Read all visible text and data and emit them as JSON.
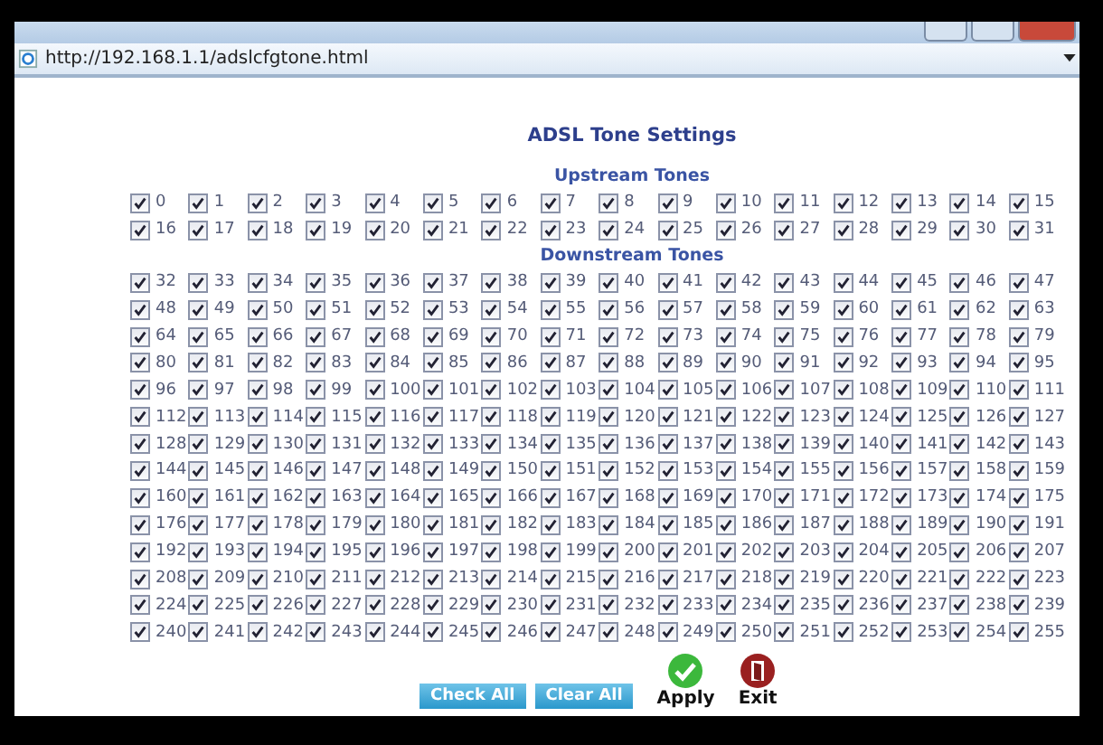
{
  "address_bar": {
    "url": "http://192.168.1.1/adslcfgtone.html"
  },
  "page": {
    "title": "ADSL Tone Settings",
    "upstream": {
      "heading": "Upstream Tones",
      "tones": [
        {
          "label": "0",
          "checked": true
        },
        {
          "label": "1",
          "checked": true
        },
        {
          "label": "2",
          "checked": true
        },
        {
          "label": "3",
          "checked": true
        },
        {
          "label": "4",
          "checked": true
        },
        {
          "label": "5",
          "checked": true
        },
        {
          "label": "6",
          "checked": true
        },
        {
          "label": "7",
          "checked": true
        },
        {
          "label": "8",
          "checked": true
        },
        {
          "label": "9",
          "checked": true
        },
        {
          "label": "10",
          "checked": true
        },
        {
          "label": "11",
          "checked": true
        },
        {
          "label": "12",
          "checked": true
        },
        {
          "label": "13",
          "checked": true
        },
        {
          "label": "14",
          "checked": true
        },
        {
          "label": "15",
          "checked": true
        },
        {
          "label": "16",
          "checked": true
        },
        {
          "label": "17",
          "checked": true
        },
        {
          "label": "18",
          "checked": true
        },
        {
          "label": "19",
          "checked": true
        },
        {
          "label": "20",
          "checked": true
        },
        {
          "label": "21",
          "checked": true
        },
        {
          "label": "22",
          "checked": true
        },
        {
          "label": "23",
          "checked": true
        },
        {
          "label": "24",
          "checked": true
        },
        {
          "label": "25",
          "checked": true
        },
        {
          "label": "26",
          "checked": true
        },
        {
          "label": "27",
          "checked": true
        },
        {
          "label": "28",
          "checked": true
        },
        {
          "label": "29",
          "checked": true
        },
        {
          "label": "30",
          "checked": true
        },
        {
          "label": "31",
          "checked": true
        }
      ]
    },
    "downstream": {
      "heading": "Downstream Tones",
      "tones": [
        {
          "label": "32",
          "checked": true
        },
        {
          "label": "33",
          "checked": true
        },
        {
          "label": "34",
          "checked": true
        },
        {
          "label": "35",
          "checked": true
        },
        {
          "label": "36",
          "checked": true
        },
        {
          "label": "37",
          "checked": true
        },
        {
          "label": "38",
          "checked": true
        },
        {
          "label": "39",
          "checked": true
        },
        {
          "label": "40",
          "checked": true
        },
        {
          "label": "41",
          "checked": true
        },
        {
          "label": "42",
          "checked": true
        },
        {
          "label": "43",
          "checked": true
        },
        {
          "label": "44",
          "checked": true
        },
        {
          "label": "45",
          "checked": true
        },
        {
          "label": "46",
          "checked": true
        },
        {
          "label": "47",
          "checked": true
        },
        {
          "label": "48",
          "checked": true
        },
        {
          "label": "49",
          "checked": true
        },
        {
          "label": "50",
          "checked": true
        },
        {
          "label": "51",
          "checked": true
        },
        {
          "label": "52",
          "checked": true
        },
        {
          "label": "53",
          "checked": true
        },
        {
          "label": "54",
          "checked": true
        },
        {
          "label": "55",
          "checked": true
        },
        {
          "label": "56",
          "checked": true
        },
        {
          "label": "57",
          "checked": true
        },
        {
          "label": "58",
          "checked": true
        },
        {
          "label": "59",
          "checked": true
        },
        {
          "label": "60",
          "checked": true
        },
        {
          "label": "61",
          "checked": true
        },
        {
          "label": "62",
          "checked": true
        },
        {
          "label": "63",
          "checked": true
        },
        {
          "label": "64",
          "checked": true
        },
        {
          "label": "65",
          "checked": true
        },
        {
          "label": "66",
          "checked": true
        },
        {
          "label": "67",
          "checked": true
        },
        {
          "label": "68",
          "checked": true
        },
        {
          "label": "69",
          "checked": true
        },
        {
          "label": "70",
          "checked": true
        },
        {
          "label": "71",
          "checked": true
        },
        {
          "label": "72",
          "checked": true
        },
        {
          "label": "73",
          "checked": true
        },
        {
          "label": "74",
          "checked": true
        },
        {
          "label": "75",
          "checked": true
        },
        {
          "label": "76",
          "checked": true
        },
        {
          "label": "77",
          "checked": true
        },
        {
          "label": "78",
          "checked": true
        },
        {
          "label": "79",
          "checked": true
        },
        {
          "label": "80",
          "checked": true
        },
        {
          "label": "81",
          "checked": true
        },
        {
          "label": "82",
          "checked": true
        },
        {
          "label": "83",
          "checked": true
        },
        {
          "label": "84",
          "checked": true
        },
        {
          "label": "85",
          "checked": true
        },
        {
          "label": "86",
          "checked": true
        },
        {
          "label": "87",
          "checked": true
        },
        {
          "label": "88",
          "checked": true
        },
        {
          "label": "89",
          "checked": true
        },
        {
          "label": "90",
          "checked": true
        },
        {
          "label": "91",
          "checked": true
        },
        {
          "label": "92",
          "checked": true
        },
        {
          "label": "93",
          "checked": true
        },
        {
          "label": "94",
          "checked": true
        },
        {
          "label": "95",
          "checked": true
        },
        {
          "label": "96",
          "checked": true
        },
        {
          "label": "97",
          "checked": true
        },
        {
          "label": "98",
          "checked": true
        },
        {
          "label": "99",
          "checked": true
        },
        {
          "label": "100",
          "checked": true
        },
        {
          "label": "101",
          "checked": true
        },
        {
          "label": "102",
          "checked": true
        },
        {
          "label": "103",
          "checked": true
        },
        {
          "label": "104",
          "checked": true
        },
        {
          "label": "105",
          "checked": true
        },
        {
          "label": "106",
          "checked": true
        },
        {
          "label": "107",
          "checked": true
        },
        {
          "label": "108",
          "checked": true
        },
        {
          "label": "109",
          "checked": true
        },
        {
          "label": "110",
          "checked": true
        },
        {
          "label": "111",
          "checked": true
        },
        {
          "label": "112",
          "checked": true
        },
        {
          "label": "113",
          "checked": true
        },
        {
          "label": "114",
          "checked": true
        },
        {
          "label": "115",
          "checked": true
        },
        {
          "label": "116",
          "checked": true
        },
        {
          "label": "117",
          "checked": true
        },
        {
          "label": "118",
          "checked": true
        },
        {
          "label": "119",
          "checked": true
        },
        {
          "label": "120",
          "checked": true
        },
        {
          "label": "121",
          "checked": true
        },
        {
          "label": "122",
          "checked": true
        },
        {
          "label": "123",
          "checked": true
        },
        {
          "label": "124",
          "checked": true
        },
        {
          "label": "125",
          "checked": true
        },
        {
          "label": "126",
          "checked": true
        },
        {
          "label": "127",
          "checked": true
        },
        {
          "label": "128",
          "checked": true
        },
        {
          "label": "129",
          "checked": true
        },
        {
          "label": "130",
          "checked": true
        },
        {
          "label": "131",
          "checked": true
        },
        {
          "label": "132",
          "checked": true
        },
        {
          "label": "133",
          "checked": true
        },
        {
          "label": "134",
          "checked": true
        },
        {
          "label": "135",
          "checked": true
        },
        {
          "label": "136",
          "checked": true
        },
        {
          "label": "137",
          "checked": true
        },
        {
          "label": "138",
          "checked": true
        },
        {
          "label": "139",
          "checked": true
        },
        {
          "label": "140",
          "checked": true
        },
        {
          "label": "141",
          "checked": true
        },
        {
          "label": "142",
          "checked": true
        },
        {
          "label": "143",
          "checked": true
        },
        {
          "label": "144",
          "checked": true
        },
        {
          "label": "145",
          "checked": true
        },
        {
          "label": "146",
          "checked": true
        },
        {
          "label": "147",
          "checked": true
        },
        {
          "label": "148",
          "checked": true
        },
        {
          "label": "149",
          "checked": true
        },
        {
          "label": "150",
          "checked": true
        },
        {
          "label": "151",
          "checked": true
        },
        {
          "label": "152",
          "checked": true
        },
        {
          "label": "153",
          "checked": true
        },
        {
          "label": "154",
          "checked": true
        },
        {
          "label": "155",
          "checked": true
        },
        {
          "label": "156",
          "checked": true
        },
        {
          "label": "157",
          "checked": true
        },
        {
          "label": "158",
          "checked": true
        },
        {
          "label": "159",
          "checked": true
        },
        {
          "label": "160",
          "checked": true
        },
        {
          "label": "161",
          "checked": true
        },
        {
          "label": "162",
          "checked": true
        },
        {
          "label": "163",
          "checked": true
        },
        {
          "label": "164",
          "checked": true
        },
        {
          "label": "165",
          "checked": true
        },
        {
          "label": "166",
          "checked": true
        },
        {
          "label": "167",
          "checked": true
        },
        {
          "label": "168",
          "checked": true
        },
        {
          "label": "169",
          "checked": true
        },
        {
          "label": "170",
          "checked": true
        },
        {
          "label": "171",
          "checked": true
        },
        {
          "label": "172",
          "checked": true
        },
        {
          "label": "173",
          "checked": true
        },
        {
          "label": "174",
          "checked": true
        },
        {
          "label": "175",
          "checked": true
        },
        {
          "label": "176",
          "checked": true
        },
        {
          "label": "177",
          "checked": true
        },
        {
          "label": "178",
          "checked": true
        },
        {
          "label": "179",
          "checked": true
        },
        {
          "label": "180",
          "checked": true
        },
        {
          "label": "181",
          "checked": true
        },
        {
          "label": "182",
          "checked": true
        },
        {
          "label": "183",
          "checked": true
        },
        {
          "label": "184",
          "checked": true
        },
        {
          "label": "185",
          "checked": true
        },
        {
          "label": "186",
          "checked": true
        },
        {
          "label": "187",
          "checked": true
        },
        {
          "label": "188",
          "checked": true
        },
        {
          "label": "189",
          "checked": true
        },
        {
          "label": "190",
          "checked": true
        },
        {
          "label": "191",
          "checked": true
        },
        {
          "label": "192",
          "checked": true
        },
        {
          "label": "193",
          "checked": true
        },
        {
          "label": "194",
          "checked": true
        },
        {
          "label": "195",
          "checked": true
        },
        {
          "label": "196",
          "checked": true
        },
        {
          "label": "197",
          "checked": true
        },
        {
          "label": "198",
          "checked": true
        },
        {
          "label": "199",
          "checked": true
        },
        {
          "label": "200",
          "checked": true
        },
        {
          "label": "201",
          "checked": true
        },
        {
          "label": "202",
          "checked": true
        },
        {
          "label": "203",
          "checked": true
        },
        {
          "label": "204",
          "checked": true
        },
        {
          "label": "205",
          "checked": true
        },
        {
          "label": "206",
          "checked": true
        },
        {
          "label": "207",
          "checked": true
        },
        {
          "label": "208",
          "checked": true
        },
        {
          "label": "209",
          "checked": true
        },
        {
          "label": "210",
          "checked": true
        },
        {
          "label": "211",
          "checked": true
        },
        {
          "label": "212",
          "checked": true
        },
        {
          "label": "213",
          "checked": true
        },
        {
          "label": "214",
          "checked": true
        },
        {
          "label": "215",
          "checked": true
        },
        {
          "label": "216",
          "checked": true
        },
        {
          "label": "217",
          "checked": true
        },
        {
          "label": "218",
          "checked": true
        },
        {
          "label": "219",
          "checked": true
        },
        {
          "label": "220",
          "checked": true
        },
        {
          "label": "221",
          "checked": true
        },
        {
          "label": "222",
          "checked": true
        },
        {
          "label": "223",
          "checked": true
        },
        {
          "label": "224",
          "checked": true
        },
        {
          "label": "225",
          "checked": true
        },
        {
          "label": "226",
          "checked": true
        },
        {
          "label": "227",
          "checked": true
        },
        {
          "label": "228",
          "checked": true
        },
        {
          "label": "229",
          "checked": true
        },
        {
          "label": "230",
          "checked": true
        },
        {
          "label": "231",
          "checked": true
        },
        {
          "label": "232",
          "checked": true
        },
        {
          "label": "233",
          "checked": true
        },
        {
          "label": "234",
          "checked": true
        },
        {
          "label": "235",
          "checked": true
        },
        {
          "label": "236",
          "checked": true
        },
        {
          "label": "237",
          "checked": true
        },
        {
          "label": "238",
          "checked": true
        },
        {
          "label": "239",
          "checked": true
        },
        {
          "label": "240",
          "checked": true
        },
        {
          "label": "241",
          "checked": true
        },
        {
          "label": "242",
          "checked": true
        },
        {
          "label": "243",
          "checked": true
        },
        {
          "label": "244",
          "checked": true
        },
        {
          "label": "245",
          "checked": true
        },
        {
          "label": "246",
          "checked": true
        },
        {
          "label": "247",
          "checked": true
        },
        {
          "label": "248",
          "checked": true
        },
        {
          "label": "249",
          "checked": true
        },
        {
          "label": "250",
          "checked": true
        },
        {
          "label": "251",
          "checked": true
        },
        {
          "label": "252",
          "checked": true
        },
        {
          "label": "253",
          "checked": true
        },
        {
          "label": "254",
          "checked": true
        },
        {
          "label": "255",
          "checked": true
        }
      ]
    },
    "buttons": [
      {
        "kind": "flat",
        "label": "Check All"
      },
      {
        "kind": "flat",
        "label": "Clear All"
      },
      {
        "kind": "apply",
        "label": "Apply"
      },
      {
        "kind": "exit",
        "label": "Exit"
      }
    ]
  }
}
